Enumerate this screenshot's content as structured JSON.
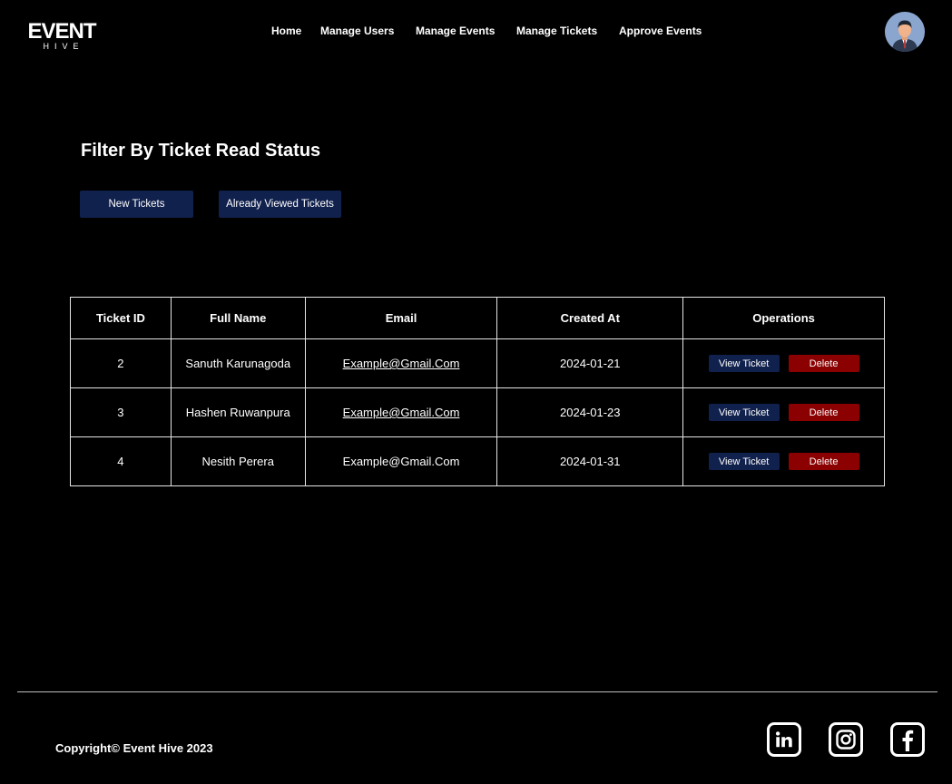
{
  "header": {
    "logo_main": "EVENT",
    "logo_sub": "HIVE",
    "nav": [
      "Home",
      "Manage Users",
      "Manage Events",
      "Manage Tickets",
      "Approve Events"
    ]
  },
  "filter": {
    "title": "Filter By Ticket Read Status",
    "new_label": "New Tickets",
    "viewed_label": "Already Viewed Tickets"
  },
  "table": {
    "headers": [
      "Ticket ID",
      "Full Name",
      "Email",
      "Created At",
      "Operations"
    ],
    "rows": [
      {
        "id": "2",
        "name": "Sanuth Karunagoda",
        "email": "Example@Gmail.Com",
        "created": "2024-01-21"
      },
      {
        "id": "3",
        "name": "Hashen Ruwanpura",
        "email": "Example@Gmail.Com",
        "created": "2024-01-23"
      },
      {
        "id": "4",
        "name": "Nesith Perera",
        "email": "Example@Gmail.Com",
        "created": "2024-01-31"
      }
    ],
    "view_label": "View Ticket",
    "delete_label": "Delete"
  },
  "footer": {
    "copyright": "Copyright© Event Hive 2023",
    "social_icons": [
      "linkedin-icon",
      "instagram-icon",
      "facebook-icon"
    ]
  },
  "colors": {
    "background": "#000000",
    "primary_button": "#11214d",
    "delete_button": "#8b0000"
  }
}
